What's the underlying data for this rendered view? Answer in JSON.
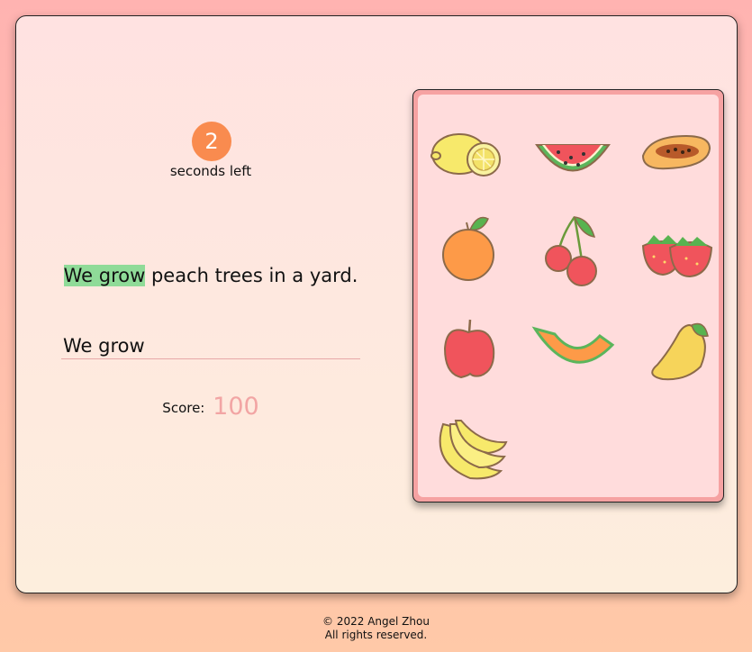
{
  "timer": {
    "value": "2",
    "label": "seconds left"
  },
  "sentence": {
    "typed": "We grow",
    "remaining": " peach trees in a yard."
  },
  "input": {
    "value": "We grow"
  },
  "score": {
    "label": "Score:",
    "value": "100"
  },
  "fruits": [
    "lemon-icon",
    "watermelon-icon",
    "papaya-icon",
    "orange-icon",
    "cherry-icon",
    "strawberry-icon",
    "apple-icon",
    "cantaloupe-icon",
    "mango-icon",
    "banana-icon"
  ],
  "footer": {
    "copyright": "© 2022 Angel Zhou",
    "rights": "All rights reserved."
  },
  "colors": {
    "accent": "#f98b4f",
    "highlight": "#8fdb98",
    "score": "#f2a5a4",
    "panel": "#f6a2a2"
  }
}
